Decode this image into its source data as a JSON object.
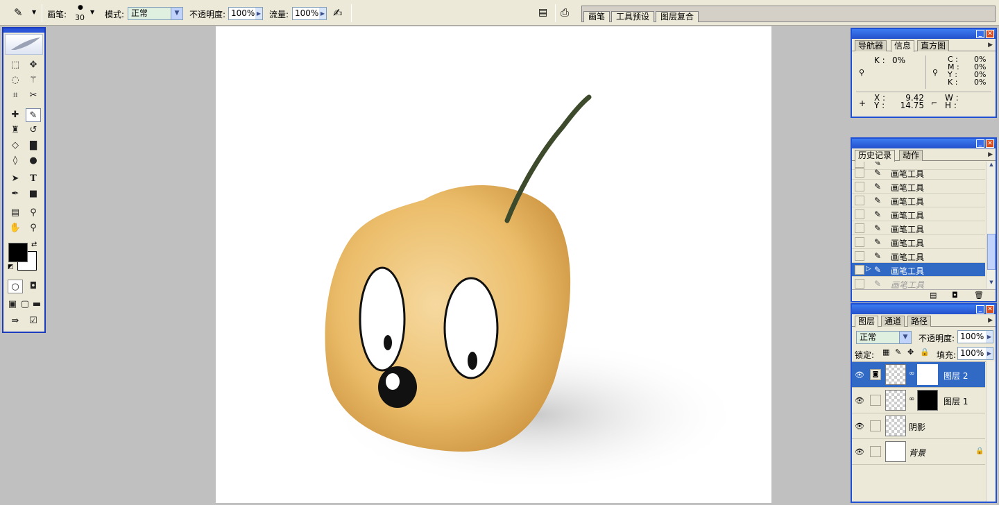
{
  "options_bar": {
    "brush_label": "画笔:",
    "brush_size": "30",
    "mode_label": "模式:",
    "mode_value": "正常",
    "opacity_label": "不透明度:",
    "opacity_value": "100%",
    "flow_label": "流量:",
    "flow_value": "100%",
    "well_tabs": [
      "画笔",
      "工具预设",
      "图层复合"
    ]
  },
  "info_panel": {
    "tabs": [
      "导航器",
      "信息",
      "直方图"
    ],
    "k_label": "K :",
    "k_value": "0%",
    "cmyk_labels": [
      "C :",
      "M :",
      "Y :",
      "K :"
    ],
    "cmyk_values": [
      "0%",
      "0%",
      "0%",
      "0%"
    ],
    "x_label": "X :",
    "x_value": "9.42",
    "y_label": "Y :",
    "y_value": "14.75",
    "w_label": "W :",
    "h_label": "H :"
  },
  "history_panel": {
    "tabs": [
      "历史记录",
      "动作"
    ],
    "items": [
      "画笔工具",
      "画笔工具",
      "画笔工具",
      "画笔工具",
      "画笔工具",
      "画笔工具",
      "画笔工具",
      "画笔工具",
      "画笔工具"
    ],
    "selected_index": 7
  },
  "layers_panel": {
    "tabs": [
      "图层",
      "通道",
      "路径"
    ],
    "blend_mode": "正常",
    "opacity_label": "不透明度:",
    "opacity_value": "100%",
    "lock_label": "锁定:",
    "fill_label": "填充:",
    "fill_value": "100%",
    "layers": [
      "图层 2",
      "图层 1",
      "阴影",
      "背景"
    ]
  },
  "colors": {
    "accent": "#316ac5",
    "panel_title": "#2350cc",
    "foreground": "#000000",
    "background": "#ffffff"
  }
}
